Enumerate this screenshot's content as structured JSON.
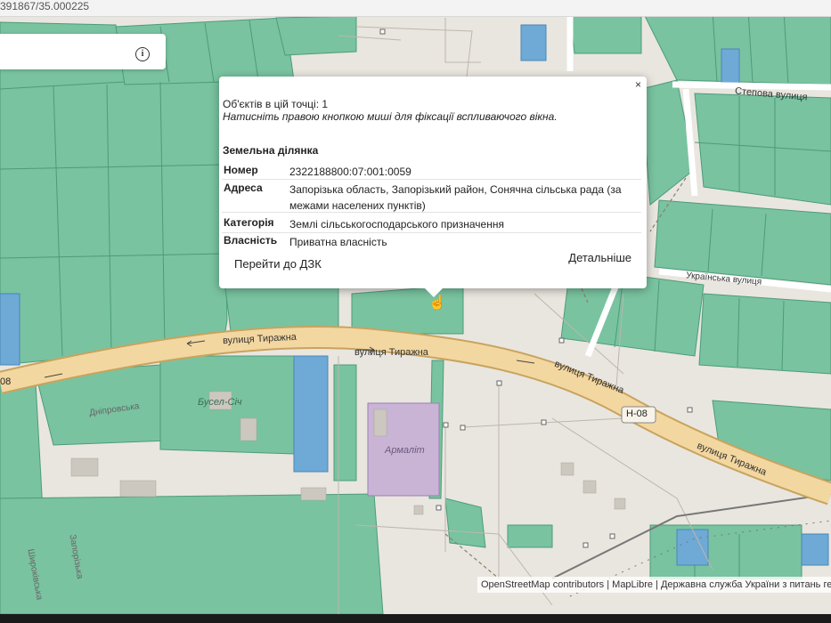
{
  "browser": {
    "url_fragment": "391867/35.000225"
  },
  "search": {
    "info_icon": "info-icon"
  },
  "popup": {
    "close": "×",
    "objects_line": "Об'єктів в цій точці: 1",
    "hint": "Натисніть правою кнопкою миші для фіксації вспливаючого вікна.",
    "section_title": "Земельна ділянка",
    "rows": [
      {
        "key": "Номер",
        "value": "2322188800:07:001:0059"
      },
      {
        "key": "Адреса",
        "value": "Запорізька область, Запорізький район, Сонячна сільська рада (за межами населених пунктів)"
      },
      {
        "key": "Категорія",
        "value": "Землі сільськогосподарського призначення"
      },
      {
        "key": "Власність",
        "value": "Приватна власність"
      }
    ],
    "goto_link": "Перейти до ДЗК",
    "details_link": "Детальніше"
  },
  "map": {
    "labels": {
      "street_tyrazhna": "вулиця Тиражна",
      "street_stepova": "Степова вулиця",
      "street_ukrainska": "Українська вулиця",
      "road_h08": "Н-08",
      "buse_sich": "Бусел-Січ",
      "armalit": "Армаліт",
      "zaporizka": "Запорізька",
      "shyrokivska": "Широківська",
      "dniprovska": "Дніпровська",
      "road_partial": "08"
    },
    "colors": {
      "parcel": "#79c3a0",
      "parcel_stroke": "#4d9b7a",
      "road": "#f3d7a0",
      "road_edge": "#c9a35e",
      "base": "#e9e6df",
      "blue_parcel": "#6fa9d6"
    }
  },
  "attribution": "OpenStreetMap contributors | MapLibre | Державна служба України з питань геод"
}
